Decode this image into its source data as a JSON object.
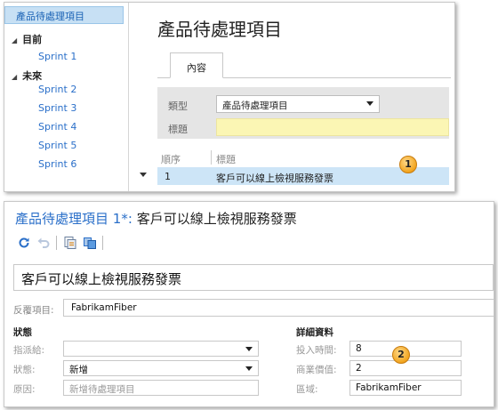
{
  "backlog": {
    "sidebar": {
      "selected": "產品待處理項目",
      "groups": [
        {
          "label": "目前",
          "items": [
            "Sprint 1"
          ]
        },
        {
          "label": "未來",
          "items": [
            "Sprint 2",
            "Sprint 3",
            "Sprint 4",
            "Sprint 5",
            "Sprint 6"
          ]
        }
      ]
    },
    "page_title": "產品待處理項目",
    "tab_label": "內容",
    "form": {
      "type_label": "類型",
      "type_value": "產品待處理項目",
      "title_label": "標題",
      "title_value": ""
    },
    "list": {
      "col_order": "順序",
      "col_title": "標題",
      "row": {
        "order": "1",
        "title": "客戶可以線上檢視服務發票"
      }
    },
    "callout": "1"
  },
  "work_item": {
    "type": "產品待處理項目",
    "id": "1*:",
    "title": "客戶可以線上檢視服務發票",
    "toolbar_icons": [
      "refresh-icon",
      "undo-icon",
      "copy-template-icon",
      "copy-item-icon"
    ],
    "iteration_label": "反覆項目:",
    "iteration_value": "FabrikamFiber",
    "status": {
      "header": "狀態",
      "assigned_label": "指派給:",
      "assigned_value": "",
      "state_label": "狀態:",
      "state_value": "新增",
      "reason_label": "原因:",
      "reason_value": "新增待處理項目"
    },
    "details": {
      "header": "詳細資料",
      "effort_label": "投入時間:",
      "effort_value": "8",
      "value_label": "商業價值:",
      "value_value": "2",
      "area_label": "區域:",
      "area_value": "FabrikamFiber"
    },
    "callout": "2"
  },
  "colors": {
    "link": "#2a6fc9",
    "selection": "#c7e0f4",
    "title_field": "#fbf6b4",
    "callout": "#f2a51f"
  }
}
